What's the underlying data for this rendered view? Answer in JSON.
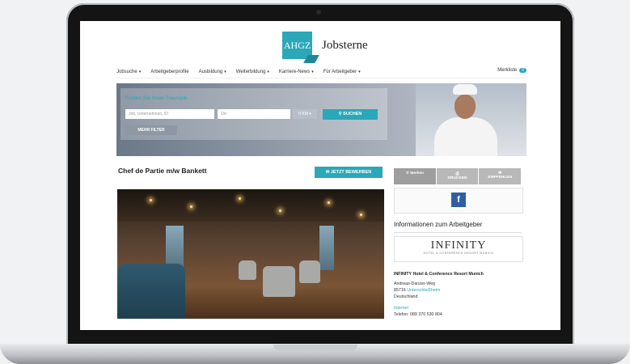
{
  "logo": {
    "badge_text": "AHGZ",
    "name": "Jobsterne"
  },
  "nav": {
    "items": [
      "Jobsuche",
      "Arbeitgeberprofile",
      "Ausbildung",
      "Weiterbildung",
      "Karriere-News",
      "Für Arbeitgeber"
    ],
    "merkliste_label": "Merkliste",
    "merkliste_count": "0"
  },
  "search": {
    "title": "Finden Sie Ihren Traumjob",
    "keyword_placeholder": "Job, Unternehmen, ID",
    "location_placeholder": "Ort",
    "radius": "0 KM",
    "search_button": "SUCHEN",
    "more_filter": "MEHR FILTER"
  },
  "job": {
    "title": "Chef de Partie m/w Bankett",
    "apply_button": "JETZT BEWERBEN"
  },
  "sidebar": {
    "tabs": [
      "Merken",
      "DRUCKEN",
      "EMPFEHLEN"
    ],
    "info_title": "Informationen zum Arbeitgeber",
    "employer_logo": "INFINITY",
    "employer_logo_sub": "HOTEL & CONFERENCE RESORT MUNICH",
    "company_name": "INFINITY Hotel & Conference Resort Munich",
    "street": "Andreas-Danzer-Weg",
    "zip": "85716",
    "city": "Unterschleißheim",
    "country": "Deutschland",
    "internet_label": "Internet",
    "phone": "Telefon: 089 370 530 804"
  },
  "colors": {
    "accent": "#2aa8b8",
    "facebook": "#2f5fa0"
  }
}
